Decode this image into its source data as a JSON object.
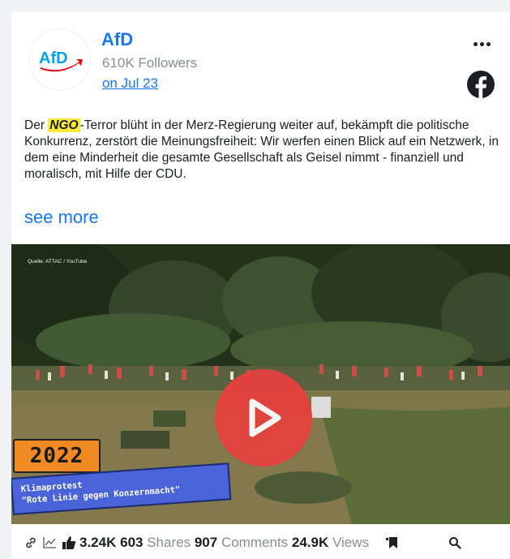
{
  "post": {
    "page_name": "AfD",
    "followers": "610K Followers",
    "date": "on Jul 23",
    "avatar_logo_text": "AfD",
    "text_before": "Der ",
    "text_highlight": "NGO",
    "text_after": "-Terror blüht in der Merz-Regierung weiter auf, bekämpft die politische Konkurrenz, zerstört die Meinungsfreiheit: Wir werfen einen Blick auf ein Netzwerk, in dem eine Minderheit die gesamte Gesellschaft als Geisel nimmt - finanziell und moralisch, mit Hilfe der CDU.",
    "see_more": "see more"
  },
  "video": {
    "source": "Quelle: ATTAC / YouTube",
    "year_badge": "2022",
    "caption_line1": "Klimaprotest",
    "caption_line2": "\"Rote Linie gegen Konzernmacht\""
  },
  "stats": {
    "likes": "3.24K",
    "shares_count": "603",
    "shares_label": "Shares",
    "comments_count": "907",
    "comments_label": "Comments",
    "views_count": "24.9K",
    "views_label": "Views"
  },
  "icons": {
    "more": "more-horizontal-icon",
    "facebook": "facebook-icon",
    "link": "link-icon",
    "chart": "chart-icon",
    "like": "thumbs-up-icon",
    "bookmark": "bookmark-icon",
    "search": "search-icon"
  },
  "colors": {
    "brand_blue": "#1877f2",
    "highlight": "#ffeb3b",
    "play": "#e8403e",
    "afd_blue": "#00a2e8",
    "afd_red": "#e30613"
  }
}
